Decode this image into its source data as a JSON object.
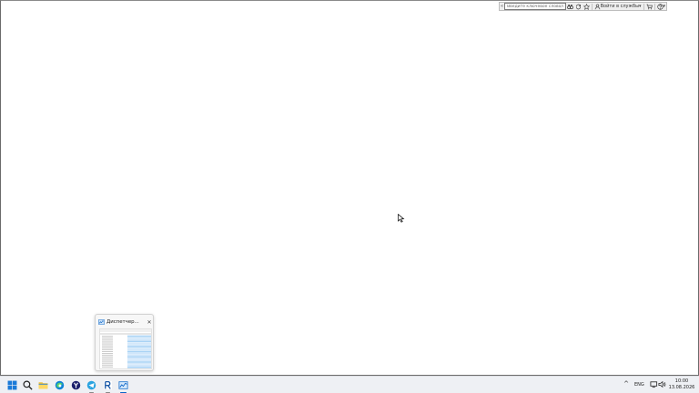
{
  "toolbar": {
    "search_placeholder": "Введите ключевое слово/фразу",
    "login_label": "Войти в службы",
    "login_chevron": "▾",
    "help_chevron": "▾",
    "search_toggle": "«"
  },
  "preview": {
    "title": "Диспетчер...",
    "close_glyph": "✕",
    "rows": 20
  },
  "taskbar": {
    "apps": [
      "windows-start",
      "search",
      "file-explorer",
      "edge",
      "yandex-browser",
      "telegram",
      "revit",
      "task-manager"
    ]
  },
  "tray": {
    "chevron": "^",
    "language": "ENG",
    "time": "10:00",
    "date": "13.08.2026"
  },
  "colors": {
    "accent_blue": "#0a64c8",
    "taskbar_bg": "#eef0f4",
    "explorer_yellow": "#f3c33c"
  }
}
